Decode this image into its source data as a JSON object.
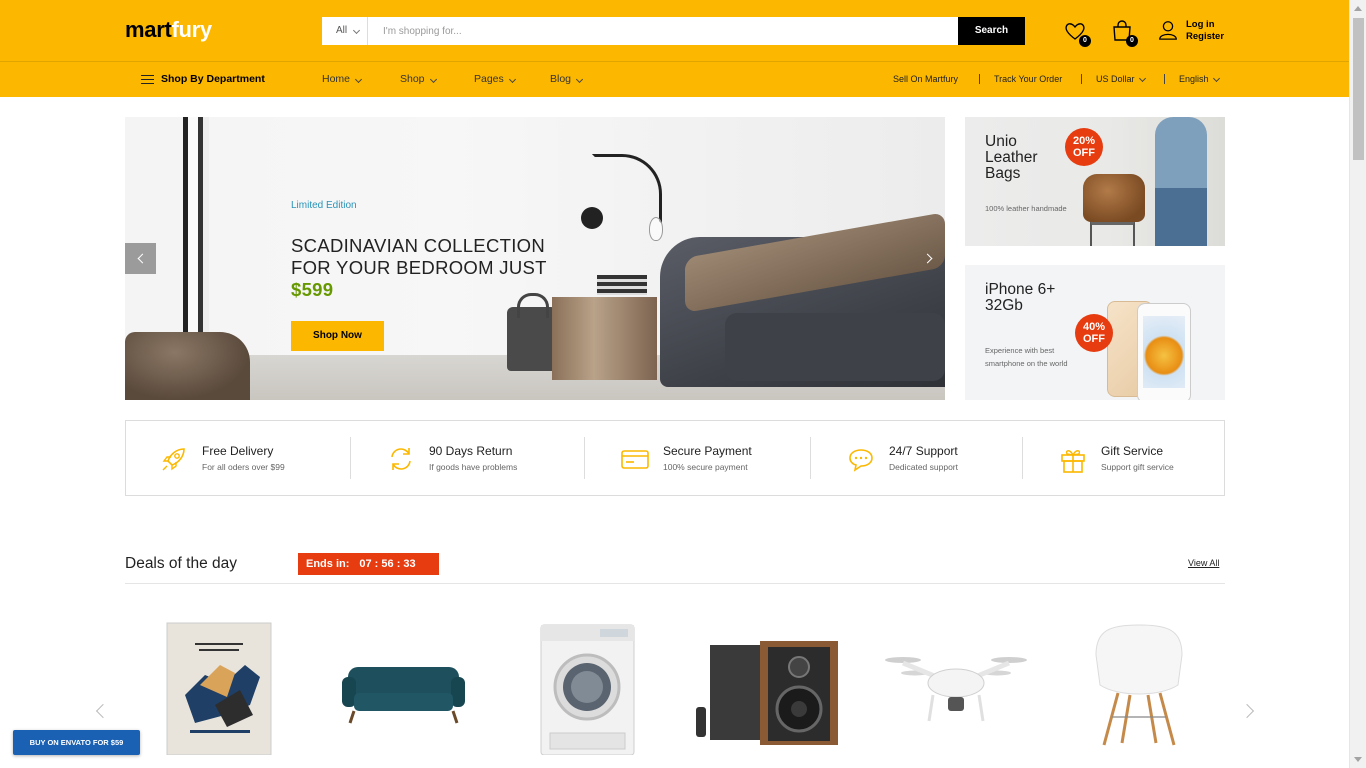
{
  "header": {
    "logo_part1": "mart",
    "logo_part2": "fury",
    "search_category": "All",
    "search_placeholder": "I'm shopping for...",
    "search_button": "Search",
    "wishlist_count": "0",
    "cart_count": "0",
    "login_label": "Log in",
    "register_label": "Register"
  },
  "nav": {
    "department": "Shop By Department",
    "items": [
      {
        "label": "Home"
      },
      {
        "label": "Shop"
      },
      {
        "label": "Pages"
      },
      {
        "label": "Blog"
      }
    ],
    "sell": "Sell On Martfury",
    "track": "Track Your Order",
    "currency": "US Dollar",
    "language": "English"
  },
  "hero": {
    "tag": "Limited Edition",
    "title": "SCADINAVIAN COLLECTION FOR YOUR BEDROOM JUST ",
    "price": "$599",
    "button": "Shop Now"
  },
  "promos": [
    {
      "title": "Unio Leather Bags",
      "description": "100% leather handmade",
      "badge_line1": "20%",
      "badge_line2": "OFF"
    },
    {
      "title": "iPhone 6+ 32Gb",
      "description": "Experience with best smartphone on the world",
      "badge_line1": "40%",
      "badge_line2": "OFF"
    }
  ],
  "features": [
    {
      "title": "Free Delivery",
      "subtitle": "For all oders over $99",
      "icon": "rocket-icon"
    },
    {
      "title": "90 Days Return",
      "subtitle": "If goods have problems",
      "icon": "refresh-icon"
    },
    {
      "title": "Secure Payment",
      "subtitle": "100% secure payment",
      "icon": "credit-card-icon"
    },
    {
      "title": "24/7 Support",
      "subtitle": "Dedicated support",
      "icon": "chat-icon"
    },
    {
      "title": "Gift Service",
      "subtitle": "Support gift service",
      "icon": "gift-icon"
    }
  ],
  "deals": {
    "title": "Deals of the day",
    "ends_label": "Ends in:",
    "countdown": "07 : 56 : 33",
    "view_all": "View All",
    "products": [
      {
        "name": "book"
      },
      {
        "name": "sofa"
      },
      {
        "name": "washing-machine"
      },
      {
        "name": "speakers"
      },
      {
        "name": "drone"
      },
      {
        "name": "chair"
      }
    ]
  },
  "envato_button": "BUY ON ENVATO FOR $59",
  "colors": {
    "accent": "#fcb800",
    "sale": "#e63c10",
    "price": "#669900",
    "link": "#2a93b8",
    "envato": "#1a61b3"
  }
}
